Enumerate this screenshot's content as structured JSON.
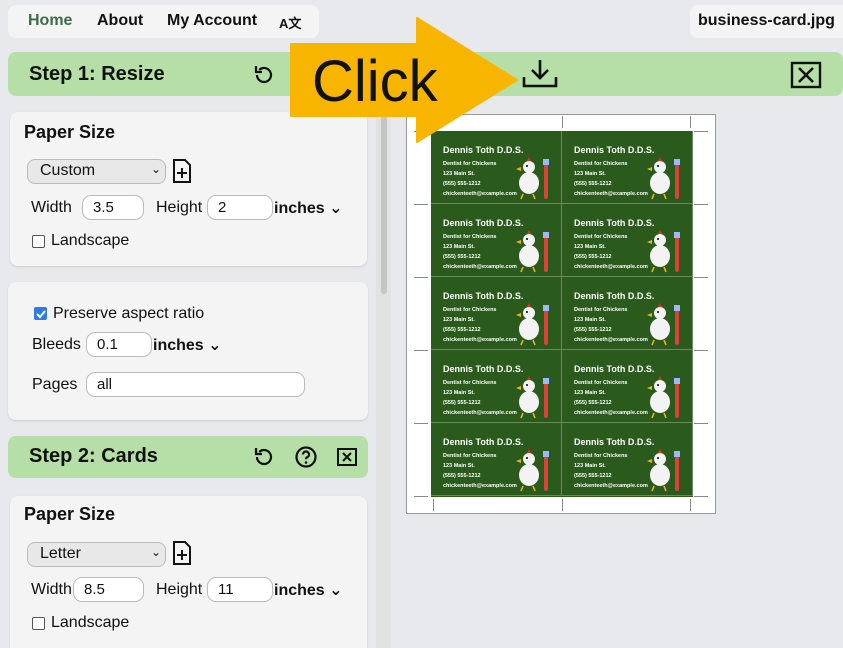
{
  "nav": {
    "home": "Home",
    "about": "About",
    "account": "My Account",
    "lang_icon": "A文"
  },
  "file": {
    "name": "business-card.jpg"
  },
  "step1": {
    "title": "Step 1: Resize",
    "paper_title": "Paper Size",
    "paper_select": "Custom",
    "width_label": "Width",
    "width_value": "3.5",
    "height_label": "Height",
    "height_value": "2",
    "unit": "inches",
    "landscape_label": "Landscape",
    "preserve_label": "Preserve aspect ratio",
    "bleeds_label": "Bleeds",
    "bleeds_value": "0.1",
    "bleeds_unit": "inches",
    "pages_label": "Pages",
    "pages_value": "all"
  },
  "step2": {
    "title": "Step 2: Cards",
    "paper_title": "Paper Size",
    "paper_select": "Letter",
    "width_label": "Width",
    "width_value": "8.5",
    "height_label": "Height",
    "height_value": "11",
    "unit": "inches",
    "landscape_label": "Landscape"
  },
  "overlay": {
    "text": "Click",
    "color": "#f7b500"
  },
  "card": {
    "name": "Dennis Toth D.D.S.",
    "line1": "Dentist for Chickens",
    "line2": "123 Main St.",
    "line3": "(555) 555-1212",
    "line4": "chickenteeth@example.com"
  },
  "colors": {
    "step_bar": "#b5dfa6",
    "card_bg": "#2a5a1c",
    "accent": "#3f6b4a"
  }
}
